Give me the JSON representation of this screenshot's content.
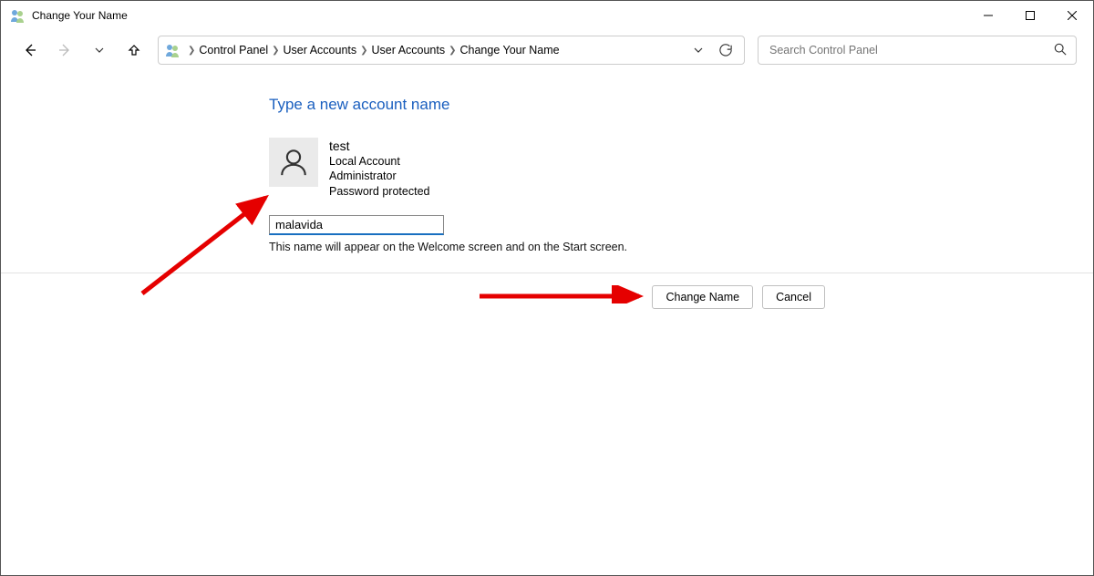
{
  "window": {
    "title": "Change Your Name"
  },
  "breadcrumb": {
    "items": [
      "Control Panel",
      "User Accounts",
      "User Accounts",
      "Change Your Name"
    ]
  },
  "search": {
    "placeholder": "Search Control Panel"
  },
  "page": {
    "heading": "Type a new account name",
    "user": {
      "name": "test",
      "type": "Local Account",
      "role": "Administrator",
      "protection": "Password protected"
    },
    "input_value": "malavida",
    "hint": "This name will appear on the Welcome screen and on the Start screen."
  },
  "buttons": {
    "primary": "Change Name",
    "secondary": "Cancel"
  }
}
